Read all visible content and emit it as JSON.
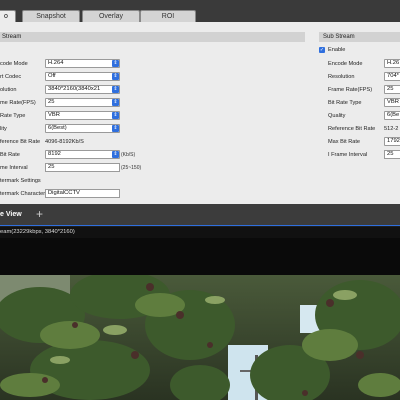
{
  "tabs": [
    {
      "label": "o",
      "active": true
    },
    {
      "label": "Snapshot",
      "active": false
    },
    {
      "label": "Overlay",
      "active": false
    },
    {
      "label": "ROI",
      "active": false
    }
  ],
  "main_stream": {
    "header": "Stream",
    "fields": {
      "encode_mode": {
        "label": "code Mode",
        "value": "H.264"
      },
      "smart_codec": {
        "label": "rt Codec",
        "value": "Off"
      },
      "resolution": {
        "label": "olution",
        "value": "3840*2160(3840x21"
      },
      "frame_rate": {
        "label": "me Rate(FPS)",
        "value": "25"
      },
      "bit_rate_type": {
        "label": "Rate Type",
        "value": "VBR"
      },
      "quality": {
        "label": "lity",
        "value": "6(Best)"
      },
      "reference_bit_rate": {
        "label": "ference Bit Rate",
        "value": "4096-8192Kb/S"
      },
      "max_bit_rate": {
        "label": "Bit Rate",
        "value": "8192",
        "unit": "(Kb/S)"
      },
      "i_frame_interval": {
        "label": "me Interval",
        "value": "25",
        "range": "(25~150)"
      },
      "watermark_settings": {
        "label": "termark Settings"
      },
      "watermark_character": {
        "label": "termark Character",
        "value": "DigitalCCTV"
      }
    }
  },
  "sub_stream": {
    "header": "Sub Stream",
    "enable_label": "Enable",
    "enabled": true,
    "fields": {
      "encode_mode": {
        "label": "Encode Mode",
        "value": "H.26"
      },
      "resolution": {
        "label": "Resolution",
        "value": "704*"
      },
      "frame_rate": {
        "label": "Frame Rate(FPS)",
        "value": "25"
      },
      "bit_rate_type": {
        "label": "Bit Rate Type",
        "value": "VBR"
      },
      "quality": {
        "label": "Quality",
        "value": "6(Be"
      },
      "reference_bit_rate": {
        "label": "Reference Bit Rate",
        "value": "512-2"
      },
      "max_bit_rate": {
        "label": "Max Bit Rate",
        "value": "1792"
      },
      "i_frame_interval": {
        "label": "I Frame Interval",
        "value": "25"
      }
    }
  },
  "live_view": {
    "title": "e View",
    "add_icon": "plus-icon",
    "stream_info": "eam(23229kbps, 3840*2160)"
  },
  "colors": {
    "accent": "#2f6fde",
    "panel_bg": "#ececec",
    "dark_bg": "#1e1e1e"
  }
}
